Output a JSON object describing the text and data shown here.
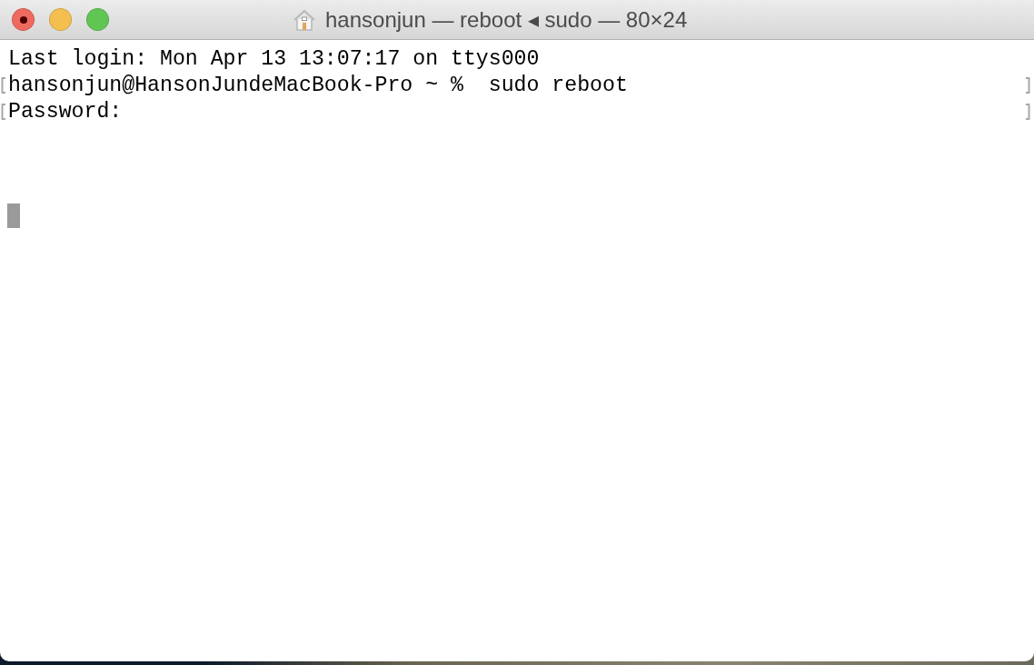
{
  "window": {
    "title": "hansonjun — reboot ◂ sudo — 80×24"
  },
  "terminal": {
    "lines": [
      {
        "text": "Last login: Mon Apr 13 13:07:17 on ttys000",
        "marked": false
      },
      {
        "text": "hansonjun@HansonJundeMacBook-Pro ~ %  sudo reboot",
        "marked": true
      },
      {
        "text": "Password:",
        "marked": true
      }
    ]
  }
}
